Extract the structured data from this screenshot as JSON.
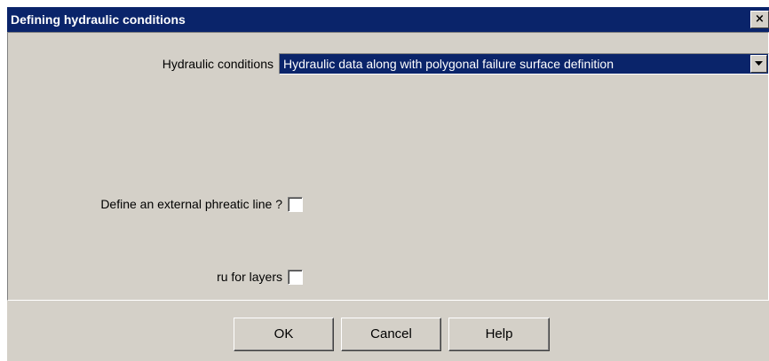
{
  "window": {
    "title": "Defining hydraulic conditions",
    "close_glyph": "×"
  },
  "form": {
    "hydraulic_conditions_label": "Hydraulic conditions",
    "hydraulic_conditions_value": "Hydraulic data along with polygonal failure surface definition",
    "phreatic_line_label": "Define an external phreatic line ?",
    "phreatic_line_checked": false,
    "ru_layers_label": "ru for layers",
    "ru_layers_checked": false
  },
  "buttons": {
    "ok": "OK",
    "cancel": "Cancel",
    "help": "Help"
  },
  "colors": {
    "titlebar": "#0a246a",
    "dialog_bg": "#d4d0c8",
    "selection": "#0a246a"
  },
  "icons": {
    "close": "close-icon",
    "dropdown": "chevron-down-icon"
  }
}
